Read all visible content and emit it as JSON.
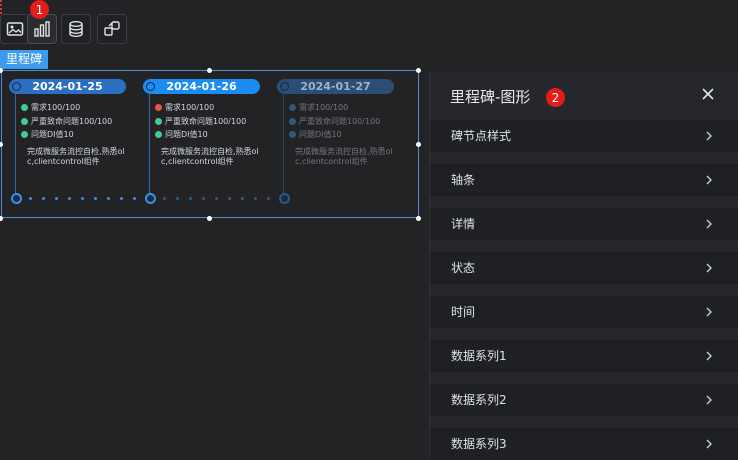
{
  "toolbar": {
    "badge1": "1",
    "buttons": [
      "image-icon",
      "bar-chart-icon",
      "database-icon",
      "shapes-icon"
    ]
  },
  "component": {
    "tag": "里程碑"
  },
  "milestones": [
    {
      "date": "2024-01-25",
      "date_color": "#2b6fc2",
      "items": [
        {
          "text": "需求100/100",
          "status": "ok"
        },
        {
          "text": "严重致命问题100/100",
          "status": "ok"
        },
        {
          "text": "问题DI值10",
          "status": "ok"
        }
      ],
      "desc": "完成微服务流控自检,熟悉ol c,clientcontrol组件"
    },
    {
      "date": "2024-01-26",
      "date_color": "#1c8df0",
      "items": [
        {
          "text": "需求100/100",
          "status": "error"
        },
        {
          "text": "严重致命问题100/100",
          "status": "ok"
        },
        {
          "text": "问题DI值10",
          "status": "ok"
        }
      ],
      "desc": "完成微服务流控自检,熟悉ol c,clientcontrol组件"
    },
    {
      "date": "2024-01-27",
      "date_color": "#2b4e74",
      "items": [
        {
          "text": "需求100/100",
          "status": "pending"
        },
        {
          "text": "严重致命问题100/100",
          "status": "pending"
        },
        {
          "text": "问题DI值10",
          "status": "pending"
        }
      ],
      "desc": "完成微服务流控自检,熟悉ol c,clientcontrol组件"
    }
  ],
  "panel": {
    "title": "里程碑-图形",
    "badge": "2",
    "rows": [
      "碑节点样式",
      "轴条",
      "详情",
      "状态",
      "时间",
      "数据系列1",
      "数据系列2",
      "数据系列3"
    ]
  },
  "colors": {
    "accent": "#3c9bf0",
    "ok": "#3ecf8e",
    "error": "#e2574c",
    "badge": "#e41c1c"
  }
}
